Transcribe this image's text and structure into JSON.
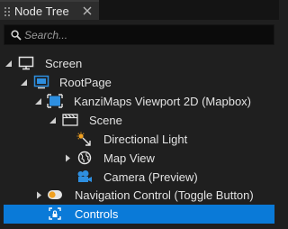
{
  "panel": {
    "tab_title": "Node Tree",
    "search_placeholder": "Search..."
  },
  "tree": {
    "items": [
      {
        "label": "Screen",
        "icon": "screen-icon",
        "expanded": true
      },
      {
        "label": "RootPage",
        "icon": "page-icon",
        "expanded": true
      },
      {
        "label": "KanziMaps Viewport 2D (Mapbox)",
        "icon": "viewport-icon",
        "expanded": true
      },
      {
        "label": "Scene",
        "icon": "scene-icon",
        "expanded": null
      },
      {
        "label": "Directional Light",
        "icon": "directional-light-icon",
        "expanded": null
      },
      {
        "label": "Map View",
        "icon": "map-view-icon",
        "expanded": false
      },
      {
        "label": "Camera (Preview)",
        "icon": "camera-icon",
        "expanded": null
      },
      {
        "label": "Navigation Control (Toggle Button)",
        "icon": "toggle-button-icon",
        "expanded": false
      },
      {
        "label": "Controls",
        "icon": "controls-node-icon",
        "expanded": null,
        "selected": true
      }
    ]
  },
  "colors": {
    "selection": "#0a7ad8",
    "icon_blue": "#2e8fe0",
    "icon_orange": "#f0a020",
    "background": "#1f1f1f"
  }
}
